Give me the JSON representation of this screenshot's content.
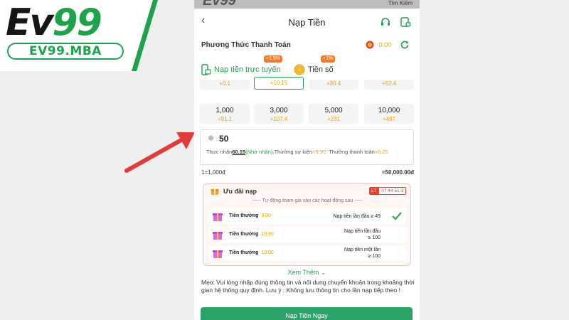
{
  "logo": {
    "main_prefix": "Ev",
    "main_suffix": "99",
    "sub": "EV99.MBA"
  },
  "status_bar": {
    "brand": "Ev99",
    "search_label": "Tìm Kiếm"
  },
  "header": {
    "title": "Nạp Tiền"
  },
  "payment": {
    "section_title": "Phương Thức Thanh Toán",
    "balance": "0.00"
  },
  "tabs": [
    {
      "label": "Nạp tiền trực tuyến",
      "badge": "+1.5%"
    },
    {
      "label": "Tiền số",
      "badge": "+1%"
    }
  ],
  "amount_options": [
    {
      "value": "",
      "bonus": "+0.1"
    },
    {
      "value": "",
      "bonus": "+10.15"
    },
    {
      "value": "",
      "bonus": "+30.4"
    },
    {
      "value": "",
      "bonus": "+52.4"
    },
    {
      "value": "1,000",
      "bonus": "+91.1"
    },
    {
      "value": "3,000",
      "bonus": "+107.4"
    },
    {
      "value": "5,000",
      "bonus": "+231"
    },
    {
      "value": "10,000",
      "bonus": "+497"
    }
  ],
  "input": {
    "value": "50",
    "receive_label": "Thực nhận",
    "receive_value": "60.15",
    "receive_note": "(Nhớ nhận)",
    "event_label": ",Thưởng sự kiện",
    "event_value": "+9.90",
    "pay_bonus_label": "Thưởng thanh toán",
    "pay_bonus_value": "+0.25"
  },
  "rate": {
    "left": "1=1,000đ",
    "right": "=50,000.00đ"
  },
  "promo": {
    "title": "Ưu đãi nạp",
    "timer_flag": "LT",
    "timer": "07 44 51 3",
    "note": "----- Tự động tham gia vào các hoạt động sau -----",
    "rewards": [
      {
        "label": "Tiền thưởng",
        "amount": "9.90",
        "cond_line1": "Nạp tiền lần đầu ≥ 49",
        "cond_line2": ""
      },
      {
        "label": "Tiền thưởng",
        "amount": "19.90",
        "cond_line1": "Nạp tiền lần đầu",
        "cond_line2": "≥ 100"
      },
      {
        "label": "Tiền thưởng",
        "amount": "10.00",
        "cond_line1": "Nạp tiền một lần",
        "cond_line2": "≥ 100"
      }
    ]
  },
  "see_more": "Xem Thêm",
  "tip": "Mẹo:  Vui lòng nhập đúng thông tin và nội dung chuyển khoản trong khoảng thời gian hệ thống quy định. Lưu ý : Không lưu thông tin cho lần nạp tiếp theo !",
  "submit_label": "Nạp Tiền Ngay",
  "colors": {
    "brand_green": "#1fa24a",
    "button_green": "#2aa36b",
    "bonus_orange": "#e8a200",
    "arrow_red": "#e23b3b"
  }
}
